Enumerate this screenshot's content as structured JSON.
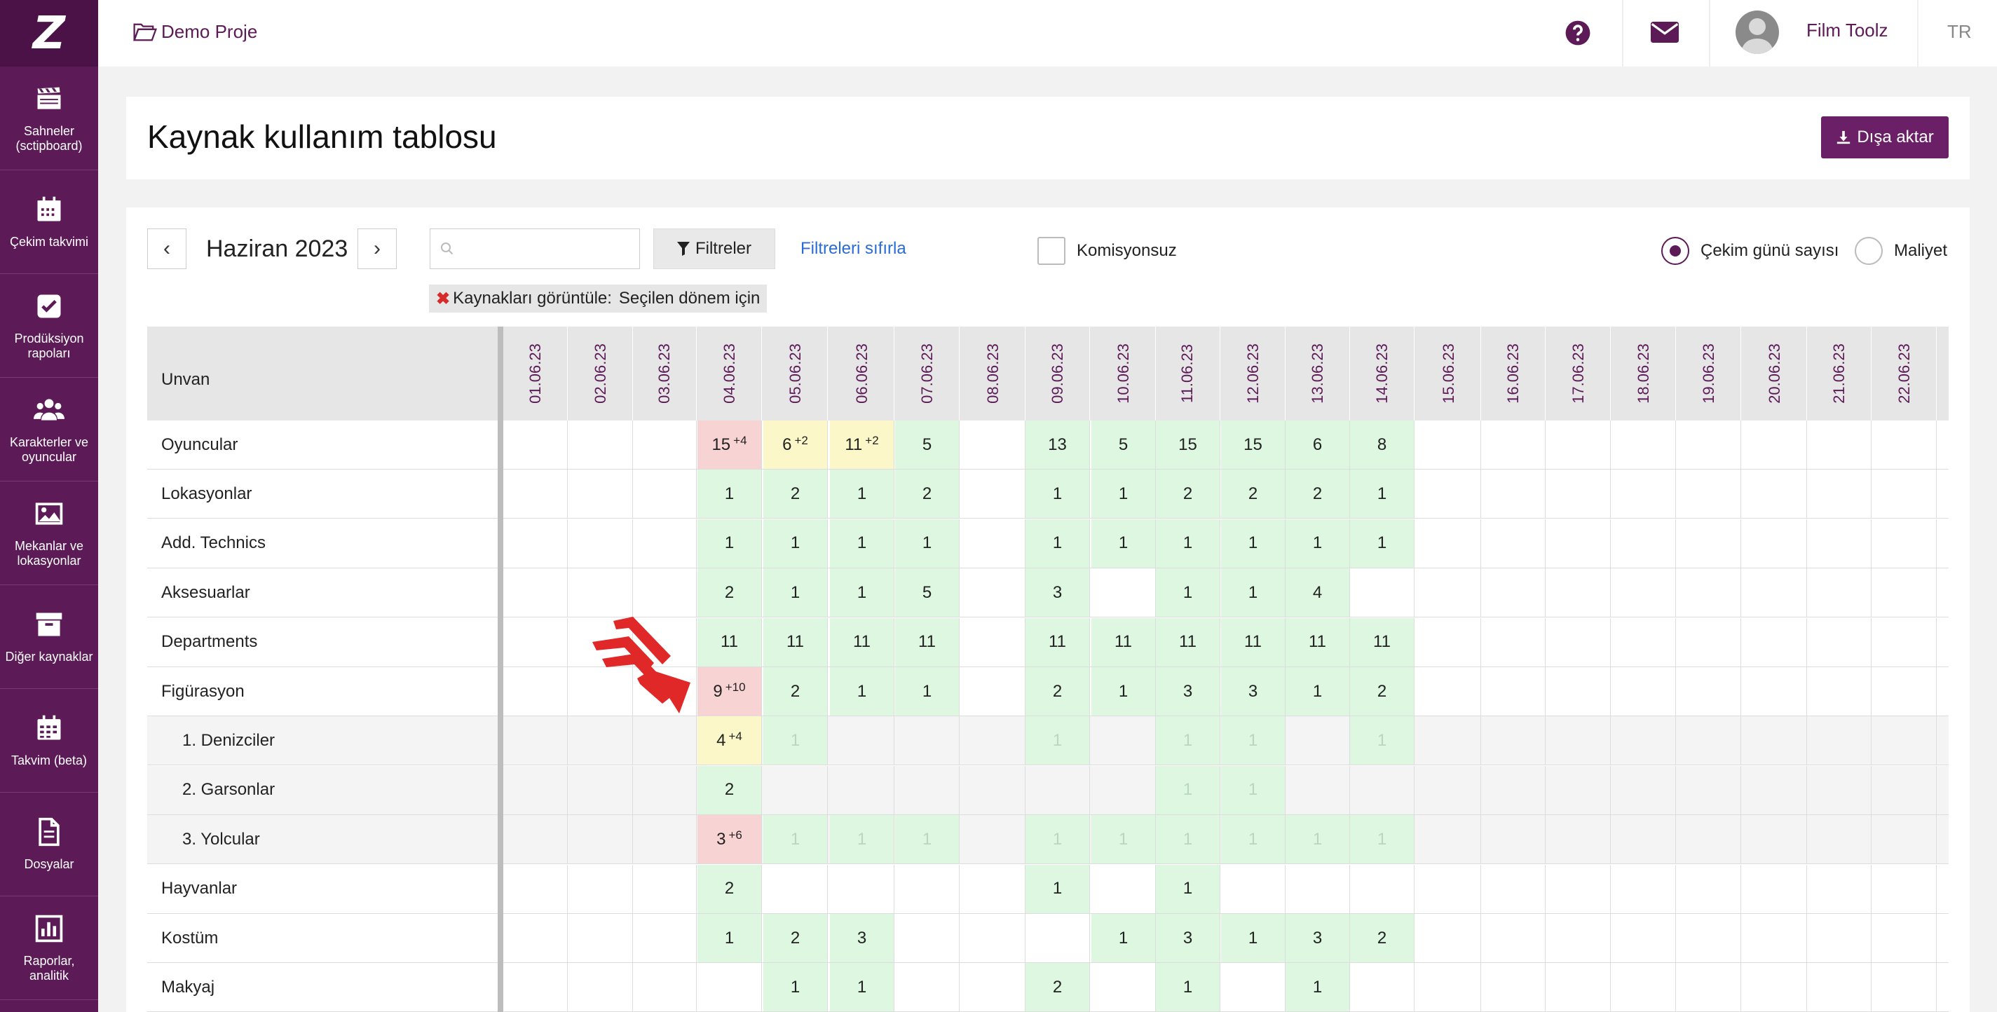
{
  "sidebar": {
    "logo": "Z",
    "items": [
      {
        "label": "Sahneler (sctipboard)",
        "icon": "clapperboard-icon"
      },
      {
        "label": "Çekim takvimi",
        "icon": "calendar-icon"
      },
      {
        "label": "Prodüksiyon rapoları",
        "icon": "checkbox-icon"
      },
      {
        "label": "Karakterler ve oyuncular",
        "icon": "users-icon"
      },
      {
        "label": "Mekanlar ve lokasyonlar",
        "icon": "image-icon"
      },
      {
        "label": "Diğer kaynaklar",
        "icon": "archive-icon"
      },
      {
        "label": "Takvim (beta)",
        "icon": "calendar-grid-icon"
      },
      {
        "label": "Dosyalar",
        "icon": "file-icon"
      },
      {
        "label": "Raporlar, analitik",
        "icon": "bar-chart-icon"
      }
    ]
  },
  "topbar": {
    "project": "Demo Proje",
    "user": "Film Toolz",
    "lang": "TR"
  },
  "page": {
    "title": "Kaynak kullanım tablosu",
    "export": "Dışa aktar"
  },
  "toolbar": {
    "prev": "‹",
    "next": "›",
    "month": "Haziran 2023",
    "search_placeholder": "",
    "filters": "Filtreler",
    "reset": "Filtreleri sıfırla",
    "no_commission": "Komisyonsuz",
    "mode_days": "Çekim günü sayısı",
    "mode_cost": "Maliyet",
    "mode_selected": "days",
    "tag_label": "Kaynakları görüntüle:",
    "tag_value": "Seçilen dönem için"
  },
  "table": {
    "header": "Unvan",
    "dates": [
      "01.06.23",
      "02.06.23",
      "03.06.23",
      "04.06.23",
      "05.06.23",
      "06.06.23",
      "07.06.23",
      "08.06.23",
      "09.06.23",
      "10.06.23",
      "11.06.23",
      "12.06.23",
      "13.06.23",
      "14.06.23",
      "15.06.23",
      "16.06.23",
      "17.06.23",
      "18.06.23",
      "19.06.23",
      "20.06.23",
      "21.06.23",
      "22.06.23"
    ],
    "rows": [
      {
        "label": "Oyuncular",
        "sub": false,
        "cells": [
          null,
          null,
          null,
          {
            "v": "15",
            "x": "+4",
            "c": "red"
          },
          {
            "v": "6",
            "x": "+2",
            "c": "yellow"
          },
          {
            "v": "11",
            "x": "+2",
            "c": "yellow"
          },
          {
            "v": "5",
            "c": "green"
          },
          null,
          {
            "v": "13",
            "c": "green"
          },
          {
            "v": "5",
            "c": "green"
          },
          {
            "v": "15",
            "c": "green"
          },
          {
            "v": "15",
            "c": "green"
          },
          {
            "v": "6",
            "c": "green"
          },
          {
            "v": "8",
            "c": "green"
          }
        ]
      },
      {
        "label": "Lokasyonlar",
        "sub": false,
        "cells": [
          null,
          null,
          null,
          {
            "v": "1",
            "c": "green"
          },
          {
            "v": "2",
            "c": "green"
          },
          {
            "v": "1",
            "c": "green"
          },
          {
            "v": "2",
            "c": "green"
          },
          null,
          {
            "v": "1",
            "c": "green"
          },
          {
            "v": "1",
            "c": "green"
          },
          {
            "v": "2",
            "c": "green"
          },
          {
            "v": "2",
            "c": "green"
          },
          {
            "v": "2",
            "c": "green"
          },
          {
            "v": "1",
            "c": "green"
          }
        ]
      },
      {
        "label": "Add. Technics",
        "sub": false,
        "cells": [
          null,
          null,
          null,
          {
            "v": "1",
            "c": "green"
          },
          {
            "v": "1",
            "c": "green"
          },
          {
            "v": "1",
            "c": "green"
          },
          {
            "v": "1",
            "c": "green"
          },
          null,
          {
            "v": "1",
            "c": "green"
          },
          {
            "v": "1",
            "c": "green"
          },
          {
            "v": "1",
            "c": "green"
          },
          {
            "v": "1",
            "c": "green"
          },
          {
            "v": "1",
            "c": "green"
          },
          {
            "v": "1",
            "c": "green"
          }
        ]
      },
      {
        "label": "Aksesuarlar",
        "sub": false,
        "cells": [
          null,
          null,
          null,
          {
            "v": "2",
            "c": "green"
          },
          {
            "v": "1",
            "c": "green"
          },
          {
            "v": "1",
            "c": "green"
          },
          {
            "v": "5",
            "c": "green"
          },
          null,
          {
            "v": "3",
            "c": "green"
          },
          null,
          {
            "v": "1",
            "c": "green"
          },
          {
            "v": "1",
            "c": "green"
          },
          {
            "v": "4",
            "c": "green"
          },
          null
        ]
      },
      {
        "label": "Departments",
        "sub": false,
        "cells": [
          null,
          null,
          null,
          {
            "v": "11",
            "c": "green"
          },
          {
            "v": "11",
            "c": "green"
          },
          {
            "v": "11",
            "c": "green"
          },
          {
            "v": "11",
            "c": "green"
          },
          null,
          {
            "v": "11",
            "c": "green"
          },
          {
            "v": "11",
            "c": "green"
          },
          {
            "v": "11",
            "c": "green"
          },
          {
            "v": "11",
            "c": "green"
          },
          {
            "v": "11",
            "c": "green"
          },
          {
            "v": "11",
            "c": "green"
          }
        ]
      },
      {
        "label": "Figürasyon",
        "sub": false,
        "cells": [
          null,
          null,
          null,
          {
            "v": "9",
            "x": "+10",
            "c": "red"
          },
          {
            "v": "2",
            "c": "green"
          },
          {
            "v": "1",
            "c": "green"
          },
          {
            "v": "1",
            "c": "green"
          },
          null,
          {
            "v": "2",
            "c": "green"
          },
          {
            "v": "1",
            "c": "green"
          },
          {
            "v": "3",
            "c": "green"
          },
          {
            "v": "3",
            "c": "green"
          },
          {
            "v": "1",
            "c": "green"
          },
          {
            "v": "2",
            "c": "green"
          }
        ]
      },
      {
        "label": "1. Denizciler",
        "sub": true,
        "cells": [
          null,
          null,
          null,
          {
            "v": "4",
            "x": "+4",
            "c": "yellow"
          },
          {
            "v": "1",
            "c": "green",
            "f": true
          },
          null,
          null,
          null,
          {
            "v": "1",
            "c": "green",
            "f": true
          },
          null,
          {
            "v": "1",
            "c": "green",
            "f": true
          },
          {
            "v": "1",
            "c": "green",
            "f": true
          },
          null,
          {
            "v": "1",
            "c": "green",
            "f": true
          }
        ]
      },
      {
        "label": "2. Garsonlar",
        "sub": true,
        "cells": [
          null,
          null,
          null,
          {
            "v": "2",
            "c": "green"
          },
          null,
          null,
          null,
          null,
          null,
          null,
          {
            "v": "1",
            "c": "green",
            "f": true
          },
          {
            "v": "1",
            "c": "green",
            "f": true
          },
          null,
          null
        ]
      },
      {
        "label": "3. Yolcular",
        "sub": true,
        "cells": [
          null,
          null,
          null,
          {
            "v": "3",
            "x": "+6",
            "c": "red"
          },
          {
            "v": "1",
            "c": "green",
            "f": true
          },
          {
            "v": "1",
            "c": "green",
            "f": true
          },
          {
            "v": "1",
            "c": "green",
            "f": true
          },
          null,
          {
            "v": "1",
            "c": "green",
            "f": true
          },
          {
            "v": "1",
            "c": "green",
            "f": true
          },
          {
            "v": "1",
            "c": "green",
            "f": true
          },
          {
            "v": "1",
            "c": "green",
            "f": true
          },
          {
            "v": "1",
            "c": "green",
            "f": true
          },
          {
            "v": "1",
            "c": "green",
            "f": true
          }
        ]
      },
      {
        "label": "Hayvanlar",
        "sub": false,
        "cells": [
          null,
          null,
          null,
          {
            "v": "2",
            "c": "green"
          },
          null,
          null,
          null,
          null,
          {
            "v": "1",
            "c": "green"
          },
          null,
          {
            "v": "1",
            "c": "green"
          },
          null,
          null,
          null
        ]
      },
      {
        "label": "Kostüm",
        "sub": false,
        "cells": [
          null,
          null,
          null,
          {
            "v": "1",
            "c": "green"
          },
          {
            "v": "2",
            "c": "green"
          },
          {
            "v": "3",
            "c": "green"
          },
          null,
          null,
          null,
          {
            "v": "1",
            "c": "green"
          },
          {
            "v": "3",
            "c": "green"
          },
          {
            "v": "1",
            "c": "green"
          },
          {
            "v": "3",
            "c": "green"
          },
          {
            "v": "2",
            "c": "green"
          }
        ]
      },
      {
        "label": "Makyaj",
        "sub": false,
        "cells": [
          null,
          null,
          null,
          null,
          {
            "v": "1",
            "c": "green"
          },
          {
            "v": "1",
            "c": "green"
          },
          null,
          null,
          {
            "v": "2",
            "c": "green"
          },
          null,
          {
            "v": "1",
            "c": "green"
          },
          null,
          {
            "v": "1",
            "c": "green"
          },
          null
        ]
      }
    ]
  },
  "colors": {
    "brand": "#5c1a57",
    "green": "#ddf7e1",
    "red": "#f8d3d3",
    "yellow": "#fbf7c8",
    "link": "#2a6cd6",
    "arrow": "#e02828"
  }
}
